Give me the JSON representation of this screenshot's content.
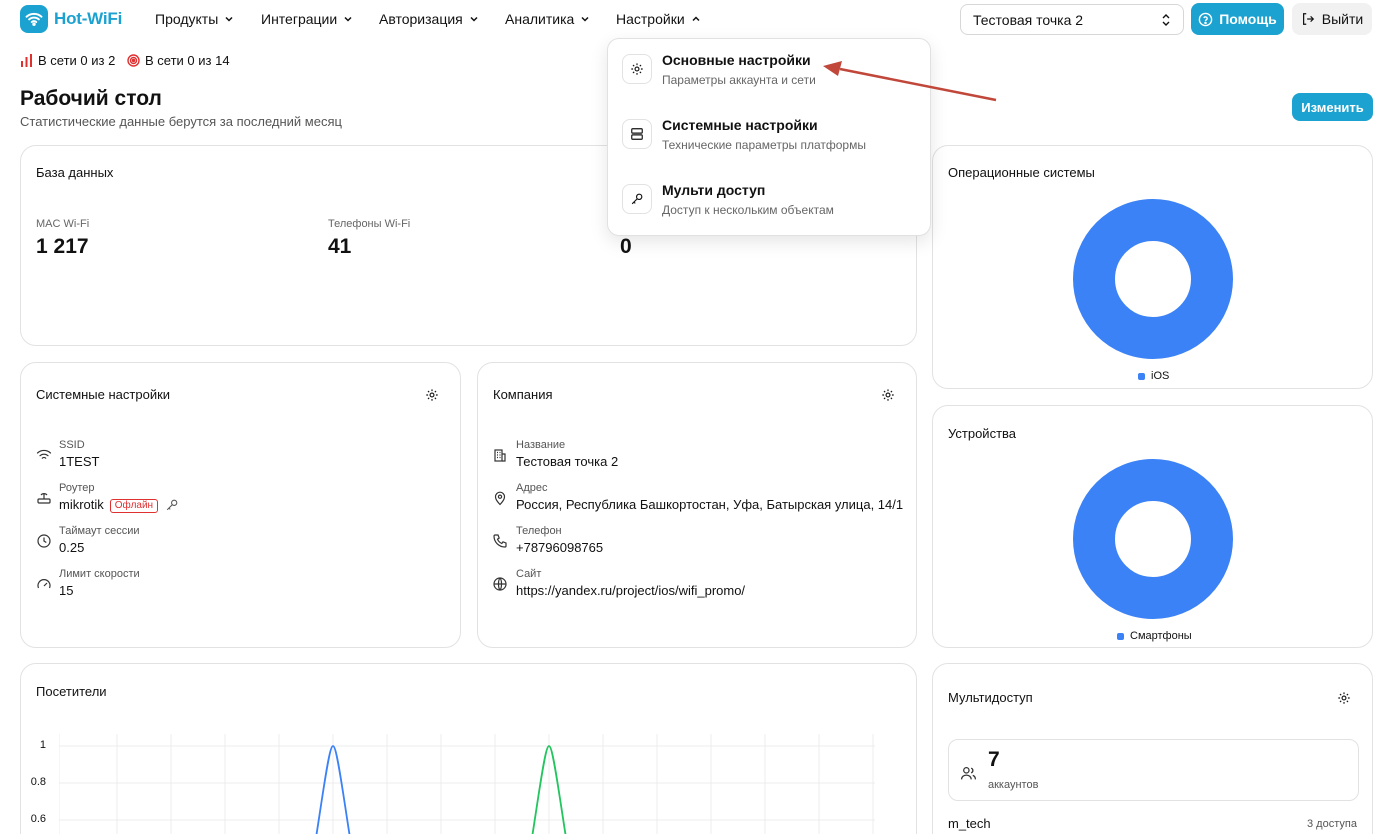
{
  "brand": {
    "name": "Hot-WiFi",
    "color": "#1ba2d0"
  },
  "nav": {
    "products": "Продукты",
    "integrations": "Интеграции",
    "authorization": "Авторизация",
    "analytics": "Аналитика",
    "settings": "Настройки"
  },
  "point_select": {
    "value": "Тестовая точка 2"
  },
  "help_label": "Помощь",
  "exit_label": "Выйти",
  "status": {
    "routers": "В сети 0 из 2",
    "points": "В сети 0 из 14"
  },
  "page": {
    "title": "Рабочий стол",
    "subtitle": "Статистические данные берутся за последний месяц",
    "edit_label": "Изменить"
  },
  "database": {
    "title": "База данных",
    "mac_label": "MAC Wi-Fi",
    "mac_value": "1 217",
    "phones_label": "Телефоны Wi-Fi",
    "phones_value": "41",
    "third_value": "0"
  },
  "system": {
    "title": "Системные настройки",
    "ssid_label": "SSID",
    "ssid_value": "1TEST",
    "router_label": "Роутер",
    "router_value": "mikrotik",
    "router_status": "Офлайн",
    "timeout_label": "Таймаут сессии",
    "timeout_value": "0.25",
    "speed_label": "Лимит скорости",
    "speed_value": "15"
  },
  "company": {
    "title": "Компания",
    "name_label": "Название",
    "name_value": "Тестовая точка 2",
    "address_label": "Адрес",
    "address_value": "Россия, Республика Башкортостан, Уфа, Батырская улица, 14/1",
    "phone_label": "Телефон",
    "phone_value": "+78796098765",
    "site_label": "Сайт",
    "site_value": "https://yandex.ru/project/ios/wifi_promo/"
  },
  "os_card": {
    "title": "Операционные системы",
    "legend": "iOS"
  },
  "devices_card": {
    "title": "Устройства",
    "legend": "Смартфоны"
  },
  "visitors": {
    "title": "Посетители",
    "y_ticks": [
      "1",
      "0.8",
      "0.6"
    ]
  },
  "multi": {
    "title": "Мультидоступ",
    "count": "7",
    "count_label": "аккаунтов",
    "user": "m_tech",
    "user_access": "3 доступа"
  },
  "dropdown": {
    "item1": {
      "title": "Основные настройки",
      "desc": "Параметры аккаунта и сети"
    },
    "item2": {
      "title": "Системные настройки",
      "desc": "Технические параметры платформы"
    },
    "item3": {
      "title": "Мульти доступ",
      "desc": "Доступ к нескольким объектам"
    }
  },
  "colors": {
    "donut": "#3b82f6",
    "line_blue": "#3b82f6",
    "line_green": "#22c55e",
    "annotation_arrow": "#c0473a"
  }
}
